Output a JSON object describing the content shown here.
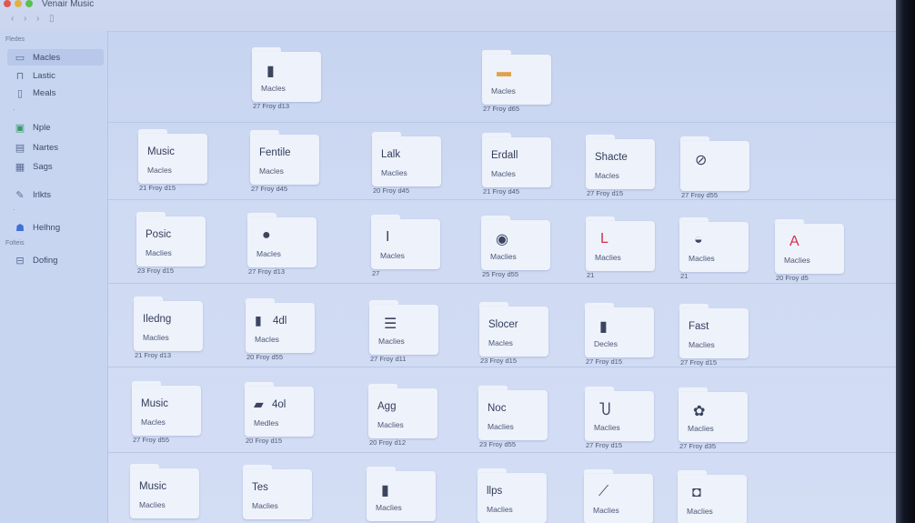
{
  "window": {
    "title": "Venair Music"
  },
  "sidebar": {
    "section_top": "Fledes",
    "section_mid": "Folteis",
    "items": [
      {
        "label": "Macles",
        "icon": "folder-icon"
      },
      {
        "label": "Lastic",
        "icon": "lock-icon"
      },
      {
        "label": "Meals",
        "icon": "document-icon"
      },
      {
        "label": "Nple",
        "icon": "grid-icon"
      },
      {
        "label": "Nartes",
        "icon": "notes-icon"
      },
      {
        "label": "Sags",
        "icon": "calendar-icon"
      },
      {
        "label": "Irlkts",
        "icon": "pencil-icon"
      },
      {
        "label": "Helhng",
        "icon": "people-icon"
      },
      {
        "label": "Dofing",
        "icon": "link-icon"
      }
    ]
  },
  "folders": [
    {
      "title": "",
      "glyph": "▮",
      "sub": "Macles",
      "meta": "27 Froy d13"
    },
    {
      "title": "",
      "glyph": "▬",
      "sub": "Macles",
      "meta": "27 Froy d65"
    },
    {
      "title": "Music",
      "glyph": "",
      "sub": "Macles",
      "meta": "21 Froy d15"
    },
    {
      "title": "Fentile",
      "glyph": "",
      "sub": "Macles",
      "meta": "27 Froy d45"
    },
    {
      "title": "Lalk",
      "glyph": "",
      "sub": "Maclies",
      "meta": "20 Froy d45"
    },
    {
      "title": "Erdall",
      "glyph": "",
      "sub": "Macles",
      "meta": "21 Froy d45"
    },
    {
      "title": "Shacte",
      "glyph": "",
      "sub": "Macles",
      "meta": "27 Froy d15"
    },
    {
      "title": "",
      "glyph": "⊘",
      "sub": "",
      "meta": "27 Froy d55"
    },
    {
      "title": "Posic",
      "glyph": "",
      "sub": "Maclies",
      "meta": "23 Froy d15"
    },
    {
      "title": "",
      "glyph": "●",
      "sub": "Macles",
      "meta": "27 Froy d13"
    },
    {
      "title": "",
      "glyph": "I",
      "sub": "Macles",
      "meta": "27"
    },
    {
      "title": "",
      "glyph": "◉",
      "sub": "Maclies",
      "meta": "25 Froy d55"
    },
    {
      "title": "",
      "glyph": "L",
      "sub": "Maclies",
      "meta": "21"
    },
    {
      "title": "",
      "glyph": "◒",
      "sub": "Maclies",
      "meta": "21"
    },
    {
      "title": "",
      "glyph": "A",
      "sub": "Maclies",
      "meta": "20 Froy d5"
    },
    {
      "title": "Iledng",
      "glyph": "",
      "sub": "Maclies",
      "meta": "21 Froy d13"
    },
    {
      "title": "4dl",
      "glyph": "▮",
      "sub": "Macles",
      "meta": "20 Froy d55"
    },
    {
      "title": "",
      "glyph": "☰",
      "sub": "Maclies",
      "meta": "27 Froy d11"
    },
    {
      "title": "Slocer",
      "glyph": "",
      "sub": "Macles",
      "meta": "23 Froy d15"
    },
    {
      "title": "",
      "glyph": "▮",
      "sub": "Decles",
      "meta": "27 Froy d15"
    },
    {
      "title": "Fast",
      "glyph": "",
      "sub": "Maclies",
      "meta": "27 Froy d15"
    },
    {
      "title": "Music",
      "glyph": "",
      "sub": "Macles",
      "meta": "27 Froy d55"
    },
    {
      "title": "4ol",
      "glyph": "▰",
      "sub": "Medles",
      "meta": "20 Froy d15"
    },
    {
      "title": "Agg",
      "glyph": "",
      "sub": "Maclies",
      "meta": "20 Froy d12"
    },
    {
      "title": "Noc",
      "glyph": "",
      "sub": "Maclies",
      "meta": "23 Froy d55"
    },
    {
      "title": "",
      "glyph": "Ⴎ",
      "sub": "Maclies",
      "meta": "27 Froy d15"
    },
    {
      "title": "",
      "glyph": "✿",
      "sub": "Maclies",
      "meta": "27 Froy d35"
    },
    {
      "title": "Music",
      "glyph": "",
      "sub": "Maclies",
      "meta": ""
    },
    {
      "title": "Tes",
      "glyph": "",
      "sub": "Maclies",
      "meta": ""
    },
    {
      "title": "",
      "glyph": "▮",
      "sub": "Maclies",
      "meta": ""
    },
    {
      "title": "llps",
      "glyph": "",
      "sub": "Maclies",
      "meta": ""
    },
    {
      "title": "",
      "glyph": "⟋",
      "sub": "Maclies",
      "meta": ""
    },
    {
      "title": "",
      "glyph": "◘",
      "sub": "Maclies",
      "meta": ""
    }
  ],
  "colors": {
    "accent_red": "#d2334b",
    "folder_orange": "#e2a24a",
    "link_blue": "#3f6fd8"
  }
}
